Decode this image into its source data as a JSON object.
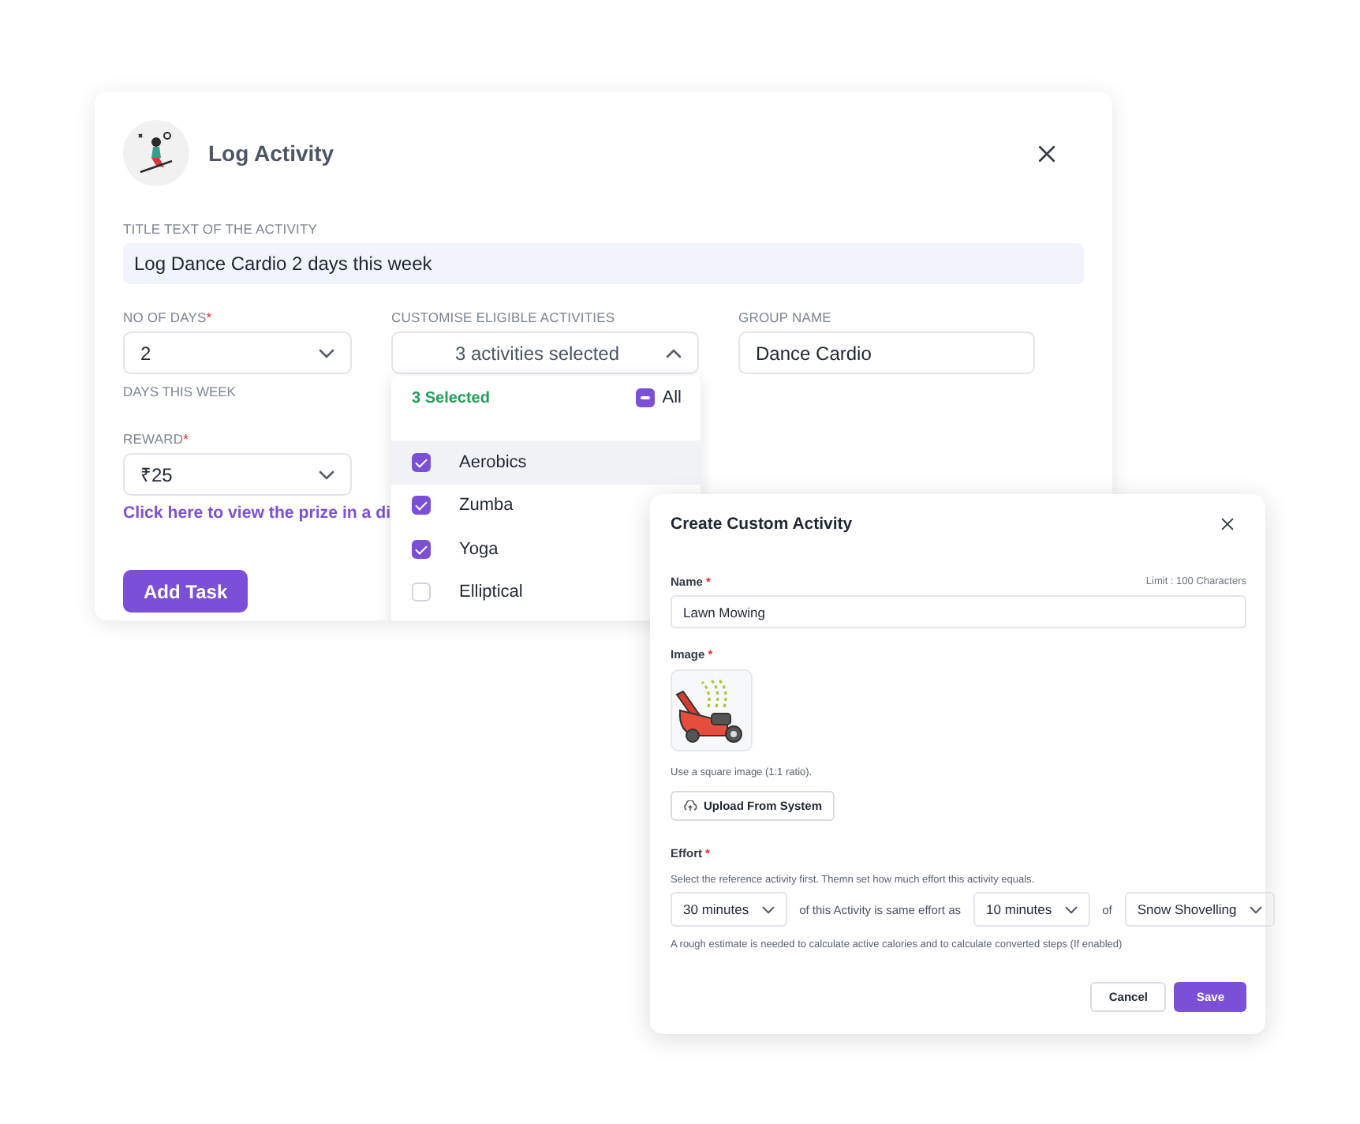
{
  "log_activity": {
    "title": "Log Activity",
    "title_field": {
      "label": "TITLE TEXT OF THE ACTIVITY",
      "value": "Log Dance Cardio 2 days this week"
    },
    "days": {
      "label": "NO OF DAYS",
      "required_mark": "*",
      "value": "2",
      "hint": "DAYS THIS WEEK"
    },
    "activities": {
      "label": "CUSTOMISE ELIGIBLE ACTIVITIES",
      "value": "3 activities selected",
      "expanded": true,
      "selected_count": "3 Selected",
      "all": {
        "label": "All",
        "indeterminate": true
      },
      "options": [
        {
          "label": "Aerobics",
          "checked": true,
          "highlighted": true
        },
        {
          "label": "Zumba",
          "checked": true,
          "highlighted": false
        },
        {
          "label": "Yoga",
          "checked": true,
          "highlighted": false
        },
        {
          "label": "Elliptical",
          "checked": false,
          "highlighted": false
        }
      ]
    },
    "group_name": {
      "label": "GROUP NAME",
      "value": "Dance Cardio"
    },
    "reward": {
      "label": "REWARD",
      "required_mark": "*",
      "value": "₹25"
    },
    "prize_link": "Click here to view the prize in a di",
    "button": "Add Task"
  },
  "custom_activity": {
    "title": "Create Custom Activity",
    "name": {
      "label": "Name",
      "required_mark": "*",
      "limit": "Limit : 100 Characters",
      "value": "Lawn Mowing"
    },
    "image": {
      "label": "Image",
      "required_mark": "*",
      "hint": "Use a square image (1:1 ratio).",
      "upload_button": "Upload From System"
    },
    "effort": {
      "label": "Effort",
      "required_mark": "*",
      "description": "Select the reference activity first. Themn set how much effort this activity equals.",
      "own_duration": "30 minutes",
      "middle_text": "of this Activity is same effort as",
      "reference_duration": "10 minutes",
      "of_text": "of",
      "reference_activity": "Snow Shovelling",
      "note": "A rough estimate is needed to calculate active calories and to calculate converted steps (If enabled)"
    },
    "buttons": [
      {
        "label": "Cancel",
        "kind": "secondary"
      },
      {
        "label": "Save",
        "kind": "primary"
      }
    ]
  }
}
